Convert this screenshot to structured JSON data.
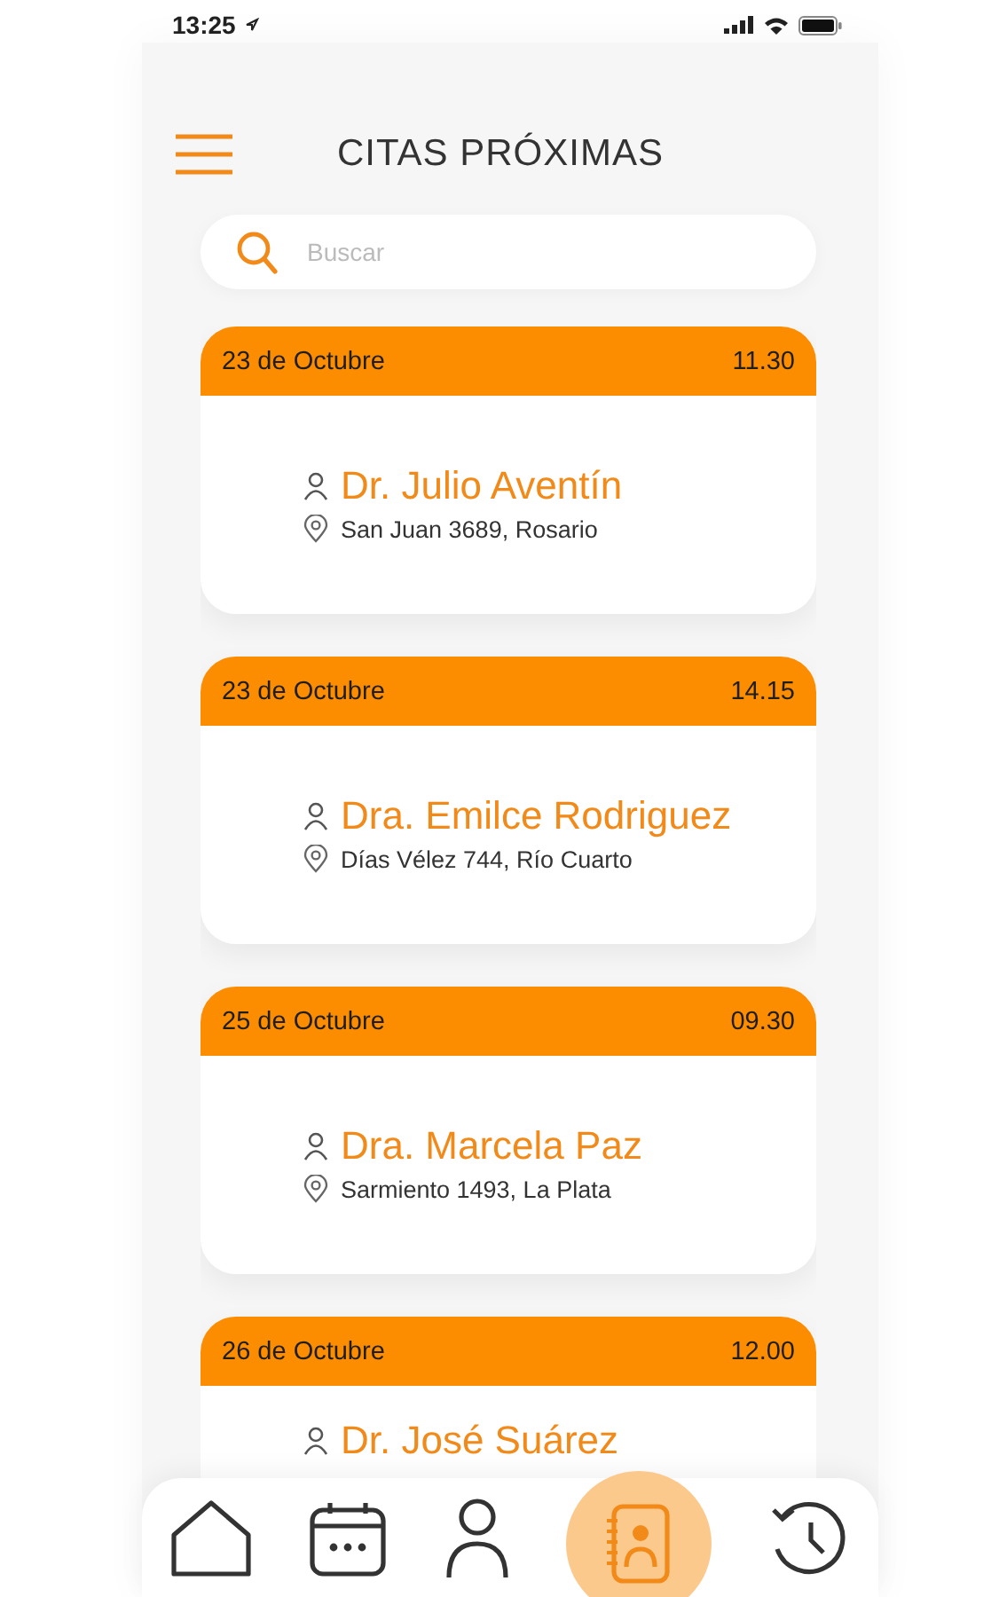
{
  "status_bar": {
    "time": "13:25"
  },
  "header": {
    "title": "CITAS PRÓXIMAS"
  },
  "search": {
    "placeholder": "Buscar"
  },
  "appointments": [
    {
      "date": "23 de Octubre",
      "time": "11.30",
      "doctor": "Dr. Julio Aventín",
      "address": "San Juan 3689, Rosario"
    },
    {
      "date": "23 de Octubre",
      "time": "14.15",
      "doctor": "Dra. Emilce Rodriguez",
      "address": "Días Vélez 744, Río Cuarto"
    },
    {
      "date": "25 de Octubre",
      "time": "09.30",
      "doctor": "Dra. Marcela Paz",
      "address": "Sarmiento 1493, La Plata"
    },
    {
      "date": "26 de Octubre",
      "time": "12.00",
      "doctor": "Dr. José Suárez"
    }
  ],
  "nav": [
    {
      "kind": "home",
      "selected": false
    },
    {
      "kind": "calendar",
      "selected": false
    },
    {
      "kind": "profile",
      "selected": false
    },
    {
      "kind": "contacts",
      "selected": true
    },
    {
      "kind": "history",
      "selected": false
    }
  ]
}
